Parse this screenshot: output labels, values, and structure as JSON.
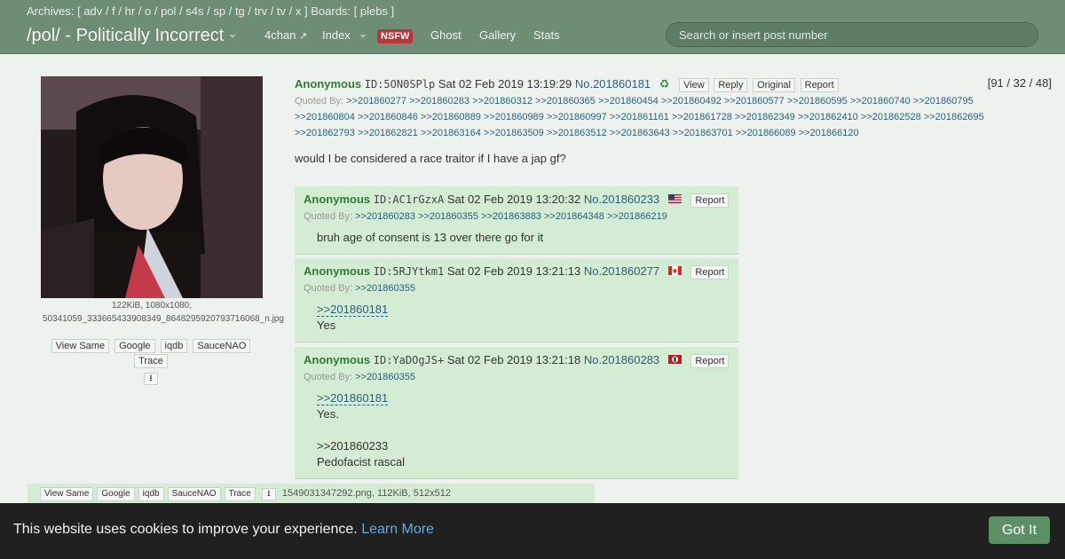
{
  "header": {
    "archives_label": "Archives:",
    "archives": [
      "adv",
      "f",
      "hr",
      "o",
      "pol",
      "s4s",
      "sp",
      "tg",
      "trv",
      "tv",
      "x"
    ],
    "boards_label": "Boards:",
    "boards": [
      "plebs"
    ],
    "board_title": "/pol/ - Politically Incorrect",
    "nav": {
      "fourchan": "4chan",
      "index": "Index",
      "nsfw": "NSFW",
      "ghost": "Ghost",
      "gallery": "Gallery",
      "stats": "Stats"
    },
    "search_placeholder": "Search or insert post number"
  },
  "op": {
    "image_info": "122KiB, 1080x1080,",
    "filename": "50341059_333665433908349_8648295920793716068_n.jpg",
    "image_buttons": [
      "View Same",
      "Google",
      "iqdb",
      "SauceNAO",
      "Trace"
    ],
    "name": "Anonymous",
    "id": "ID:5ON0SPlp",
    "date": "Sat 02 Feb 2019 13:19:29",
    "no_label": "No.",
    "number": "201860181",
    "actions": [
      "View",
      "Reply",
      "Original",
      "Report"
    ],
    "counts": "[91 / 32 / 48]",
    "quoted_by_label": "Quoted By:",
    "quoted_by_lines": [
      ">>201860277 >>201860283 >>201860312 >>201860365 >>201860454 >>201860492 >>201860577 >>201860595 >>201860740 >>201860795",
      ">>201860804 >>201860846 >>201860889 >>201860989 >>201860997 >>201861161 >>201861728 >>201862349 >>201862410 >>201862528 >>201862695",
      ">>201862793 >>201862821 >>201863164 >>201863509 >>201863512 >>201863643 >>201863701 >>201866089 >>201866120"
    ],
    "text": "would I be considered a race traitor if I have a jap gf?"
  },
  "replies": [
    {
      "name": "Anonymous",
      "id": "ID:AC1rGzxA",
      "date": "Sat 02 Feb 2019 13:20:32",
      "number": "201860233",
      "flag": "us",
      "report": "Report",
      "quoted_by": ">>201860283 >>201860355 >>201863883 >>201864348 >>201866219",
      "lines": [
        "bruh age of consent is 13 over there go for it"
      ]
    },
    {
      "name": "Anonymous",
      "id": "ID:5RJYtkm1",
      "date": "Sat 02 Feb 2019 13:21:13",
      "number": "201860277",
      "flag": "ca",
      "report": "Report",
      "quoted_by": ">>201860355",
      "quote_link": ">>201860181",
      "lines": [
        "Yes"
      ]
    },
    {
      "name": "Anonymous",
      "id": "ID:YaDOgJS+",
      "date": "Sat 02 Feb 2019 13:21:18",
      "number": "201860283",
      "flag": "nazi",
      "report": "Report",
      "quoted_by": ">>201860355",
      "quote_link": ">>201860181",
      "line1": "Yes.",
      "quote_link2": ">>201860233",
      "line2": "Pedofacist rascal"
    }
  ],
  "bottom": {
    "buttons": [
      "View Same",
      "Google",
      "iqdb",
      "SauceNAO",
      "Trace"
    ],
    "file_info": "1549031347292.png, 112KiB, 512x512"
  },
  "cookie": {
    "text": "This website uses cookies to improve your experience.",
    "learn_more": "Learn More",
    "button": "Got It"
  }
}
